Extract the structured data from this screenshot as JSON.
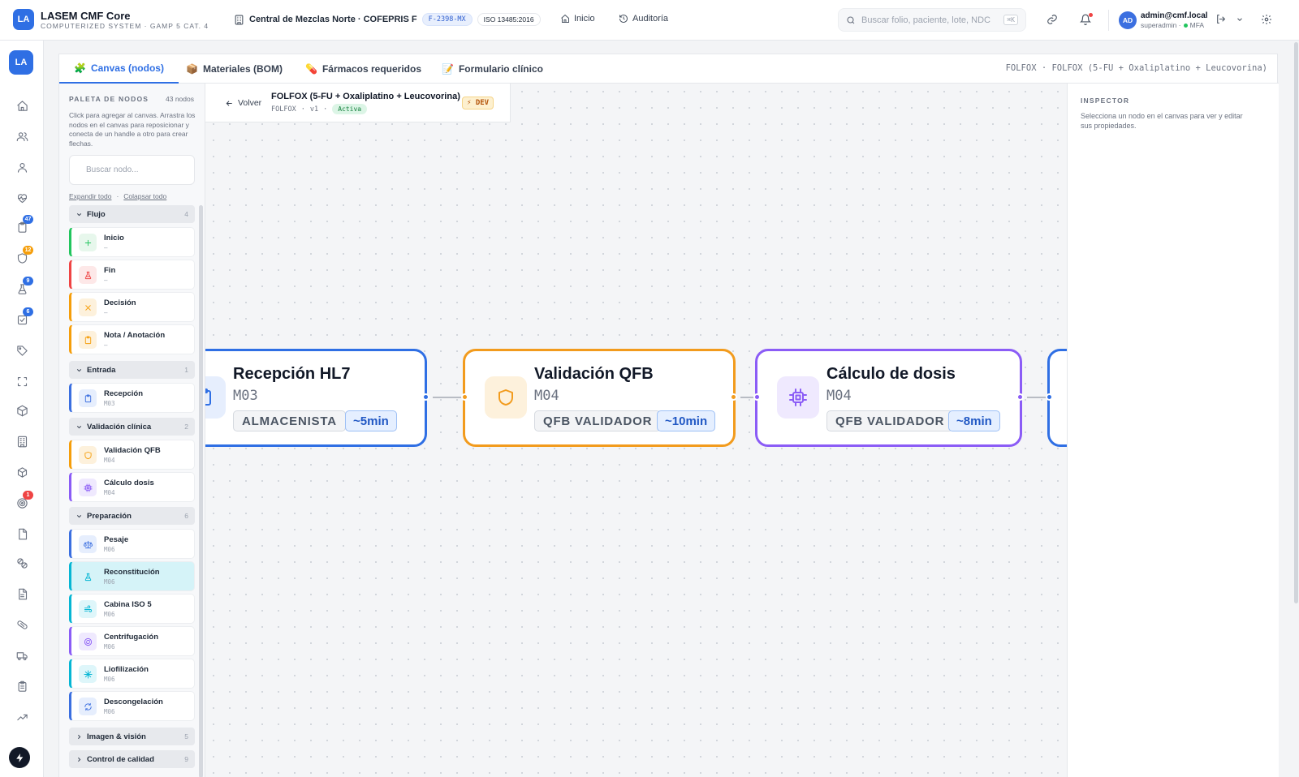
{
  "app": {
    "logo": "LA",
    "title": "LASEM CMF Core",
    "subtitle": "COMPUTERIZED SYSTEM · GAMP 5 CAT. 4"
  },
  "header": {
    "site_name": "Central de Mezclas Norte · COFEPRIS F",
    "license_badge": "F-2398-MX",
    "iso_badge": "ISO 13485:2016",
    "nav": {
      "home": "Inicio",
      "audit": "Auditoría"
    },
    "search": {
      "placeholder": "Buscar folio, paciente, lote, NDC",
      "shortcut": "⌘K"
    },
    "user": {
      "initials": "AD",
      "email": "admin@cmf.local",
      "role": "superadmin · ",
      "mfa": "MFA"
    }
  },
  "rail": {
    "logo": "LA",
    "items": [
      {
        "name": "home-icon",
        "badge": ""
      },
      {
        "name": "users-icon",
        "badge": ""
      },
      {
        "name": "user-icon",
        "badge": ""
      },
      {
        "name": "heart-pulse-icon",
        "badge": ""
      },
      {
        "name": "clipboard-icon",
        "badge": "47"
      },
      {
        "name": "shield-icon",
        "badge": "12"
      },
      {
        "name": "flask-icon",
        "badge": "9"
      },
      {
        "name": "checklist-icon",
        "badge": "6"
      },
      {
        "name": "tag-icon",
        "badge": ""
      },
      {
        "name": "scan-icon",
        "badge": ""
      },
      {
        "name": "package-icon",
        "badge": ""
      },
      {
        "name": "building-icon",
        "badge": ""
      },
      {
        "name": "box-icon",
        "badge": ""
      },
      {
        "name": "target-icon",
        "badge": "1"
      },
      {
        "name": "document-icon",
        "badge": ""
      },
      {
        "name": "pills-icon",
        "badge": ""
      },
      {
        "name": "file-icon",
        "badge": ""
      },
      {
        "name": "capsule-icon",
        "badge": ""
      },
      {
        "name": "truck-icon",
        "badge": ""
      },
      {
        "name": "clipboard-list-icon",
        "badge": ""
      },
      {
        "name": "trend-icon",
        "badge": ""
      }
    ],
    "badge_colors": {
      "blue": "#2f6fe4",
      "orange": "#f59e0b",
      "red": "#ef4444"
    }
  },
  "tabs": [
    {
      "icon": "🧩",
      "label": "Canvas (nodos)",
      "active": true
    },
    {
      "icon": "📦",
      "label": "Materiales (BOM)",
      "active": false
    },
    {
      "icon": "💊",
      "label": "Fármacos requeridos",
      "active": false
    },
    {
      "icon": "📝",
      "label": "Formulario clínico",
      "active": false
    }
  ],
  "breadcrumb": "FOLFOX · FOLFOX (5-FU + Oxaliplatino + Leucovorina)",
  "palette": {
    "title": "PALETA DE NODOS",
    "count": "43 nodos",
    "help": "Click para agregar al canvas. Arrastra los nodos en el canvas para reposicionar y conecta de un handle a otro para crear flechas.",
    "search_placeholder": "Buscar nodo...",
    "expand_all": "Expandir todo",
    "collapse_all": "Colapsar todo",
    "separator": "·",
    "groups": [
      {
        "label": "Flujo",
        "count": "4",
        "open": true
      },
      {
        "label": "Entrada",
        "count": "1",
        "open": true
      },
      {
        "label": "Validación clínica",
        "count": "2",
        "open": true
      },
      {
        "label": "Preparación",
        "count": "6",
        "open": true
      },
      {
        "label": "Imagen & visión",
        "count": "5",
        "open": false
      },
      {
        "label": "Control de calidad",
        "count": "9",
        "open": false
      }
    ],
    "nodes": [
      {
        "name": "Inicio",
        "code": "—",
        "color": "#22c55e",
        "bg": "#e7f7ec",
        "icon": "plus-icon"
      },
      {
        "name": "Fin",
        "code": "—",
        "color": "#ef4444",
        "bg": "#fde8e8",
        "icon": "flask-icon"
      },
      {
        "name": "Decisión",
        "code": "—",
        "color": "#f59e0b",
        "bg": "#fdf1dc",
        "icon": "x-icon"
      },
      {
        "name": "Nota / Anotación",
        "code": "—",
        "color": "#f59e0b",
        "bg": "#fdf1dc",
        "icon": "note-icon"
      },
      {
        "name": "Recepción",
        "code": "M03",
        "color": "#3b6fe0",
        "bg": "#e6eefd",
        "icon": "clipboard-icon"
      },
      {
        "name": "Validación QFB",
        "code": "M04",
        "color": "#f59e0b",
        "bg": "#fdf1dc",
        "icon": "shield-icon"
      },
      {
        "name": "Cálculo dosis",
        "code": "M04",
        "color": "#8b5cf6",
        "bg": "#efe9fe",
        "icon": "cpu-icon"
      },
      {
        "name": "Pesaje",
        "code": "M06",
        "color": "#3b6fe0",
        "bg": "#e6eefd",
        "icon": "scale-icon"
      },
      {
        "name": "Reconstitución",
        "code": "M06",
        "color": "#06b6d4",
        "bg": "#d5f3f8",
        "icon": "flask-icon"
      },
      {
        "name": "Cabina ISO 5",
        "code": "M06",
        "color": "#06b6d4",
        "bg": "#def6fa",
        "icon": "wind-icon"
      },
      {
        "name": "Centrifugación",
        "code": "M06",
        "color": "#8b5cf6",
        "bg": "#efe9fe",
        "icon": "spin-icon"
      },
      {
        "name": "Liofilización",
        "code": "M06",
        "color": "#06b6d4",
        "bg": "#def6fa",
        "icon": "snowflake-icon"
      },
      {
        "name": "Descongelación",
        "code": "M06",
        "color": "#3b6fe0",
        "bg": "#e6eefd",
        "icon": "refresh-icon"
      }
    ]
  },
  "flow": {
    "back": "Volver",
    "title": "FOLFOX (5-FU + Oxaliplatino + Leucovorina)",
    "code": "FOLFOX",
    "separator": "·",
    "version": "v1",
    "status": "Activa",
    "env_badge": "⚡ DEV",
    "nodes": [
      {
        "title": "Recepción HL7",
        "code": "M03",
        "role": "ALMACENISTA",
        "time": "~5min",
        "color": "#2f6fe4",
        "bg": "#e6eefd",
        "icon": "clipboard-icon"
      },
      {
        "title": "Validación QFB",
        "code": "M04",
        "role": "QFB VALIDADOR",
        "time": "~10min",
        "color": "#f29b1d",
        "bg": "#fdf1dc",
        "icon": "shield-icon"
      },
      {
        "title": "Cálculo de dosis",
        "code": "M04",
        "role": "QFB VALIDADOR",
        "time": "~8min",
        "color": "#8b5cf6",
        "bg": "#efe9fe",
        "icon": "cpu-icon"
      },
      {
        "title": "",
        "code": "",
        "role": "",
        "time": "",
        "color": "#2f6fe4",
        "bg": "#e6eefd",
        "icon": ""
      }
    ]
  },
  "inspector": {
    "title": "INSPECTOR",
    "help": "Selecciona un nodo en el canvas para ver y editar sus propiedades."
  }
}
